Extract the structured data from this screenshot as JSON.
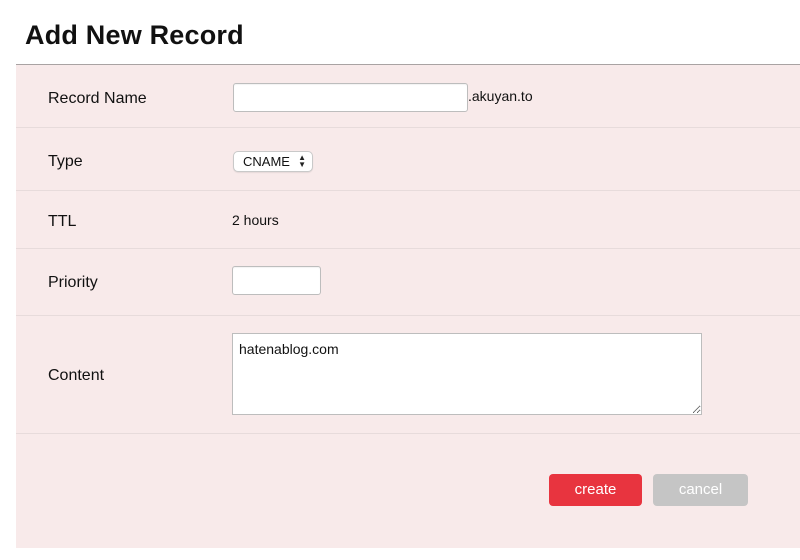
{
  "form": {
    "title": "Add New Record",
    "record_name": {
      "label": "Record Name",
      "value": "",
      "suffix": ".akuyan.to"
    },
    "type": {
      "label": "Type",
      "selected": "CNAME"
    },
    "ttl": {
      "label": "TTL",
      "value": "2 hours"
    },
    "priority": {
      "label": "Priority",
      "value": ""
    },
    "content": {
      "label": "Content",
      "value": "hatenablog.com"
    },
    "buttons": {
      "create": "create",
      "cancel": "cancel"
    }
  },
  "colors": {
    "panel_bg": "#f8eaea",
    "create_button": "#e8343f",
    "cancel_button": "#c5c5c5"
  },
  "icons": {
    "select_arrows": "up-down-arrows-icon",
    "resize_handle": "resize-grip-icon"
  }
}
